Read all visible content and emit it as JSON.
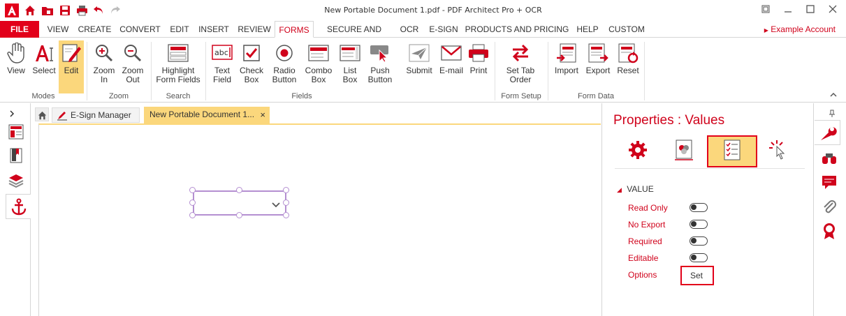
{
  "window": {
    "title": "New Portable Document 1.pdf   -   PDF Architect Pro + OCR",
    "controls": [
      "restore-icon",
      "minimize-icon",
      "maximize-icon",
      "close-icon"
    ]
  },
  "menu": {
    "file": "FILE",
    "tabs": [
      "VIEW",
      "CREATE",
      "CONVERT",
      "EDIT",
      "INSERT",
      "REVIEW",
      "FORMS",
      "SECURE AND SIGN",
      "OCR",
      "E-SIGN",
      "PRODUCTS AND PRICING",
      "HELP",
      "CUSTOM"
    ],
    "active": "FORMS",
    "account": "Example Account"
  },
  "ribbon": {
    "buttons": {
      "view": "View",
      "select": "Select",
      "edit": "Edit",
      "zoom_in_1": "Zoom",
      "zoom_in_2": "In",
      "zoom_out_1": "Zoom",
      "zoom_out_2": "Out",
      "highlight_1": "Highlight",
      "highlight_2": "Form Fields",
      "text_field_1": "Text",
      "text_field_2": "Field",
      "check_box_1": "Check",
      "check_box_2": "Box",
      "radio_1": "Radio",
      "radio_2": "Button",
      "combo_1": "Combo",
      "combo_2": "Box",
      "list_1": "List",
      "list_2": "Box",
      "push_1": "Push",
      "push_2": "Button",
      "submit": "Submit",
      "email": "E-mail",
      "print": "Print",
      "tab_order_1": "Set Tab",
      "tab_order_2": "Order",
      "import": "Import",
      "export": "Export",
      "reset": "Reset"
    },
    "groups": {
      "modes": "Modes",
      "zoom": "Zoom",
      "search": "Search",
      "fields": "Fields",
      "form_setup": "Form Setup",
      "form_data": "Form Data"
    }
  },
  "doc_tabs": {
    "esign": "E-Sign Manager",
    "document": "New Portable Document 1...",
    "close": "×"
  },
  "properties": {
    "title": "Properties : Values",
    "section": "VALUE",
    "rows": [
      "Read Only",
      "No Export",
      "Required",
      "Editable"
    ],
    "options_label": "Options",
    "options_button": "Set"
  },
  "colors": {
    "accent": "#d0021b",
    "highlight": "#fbd77c",
    "selection": "#b48fd1"
  }
}
